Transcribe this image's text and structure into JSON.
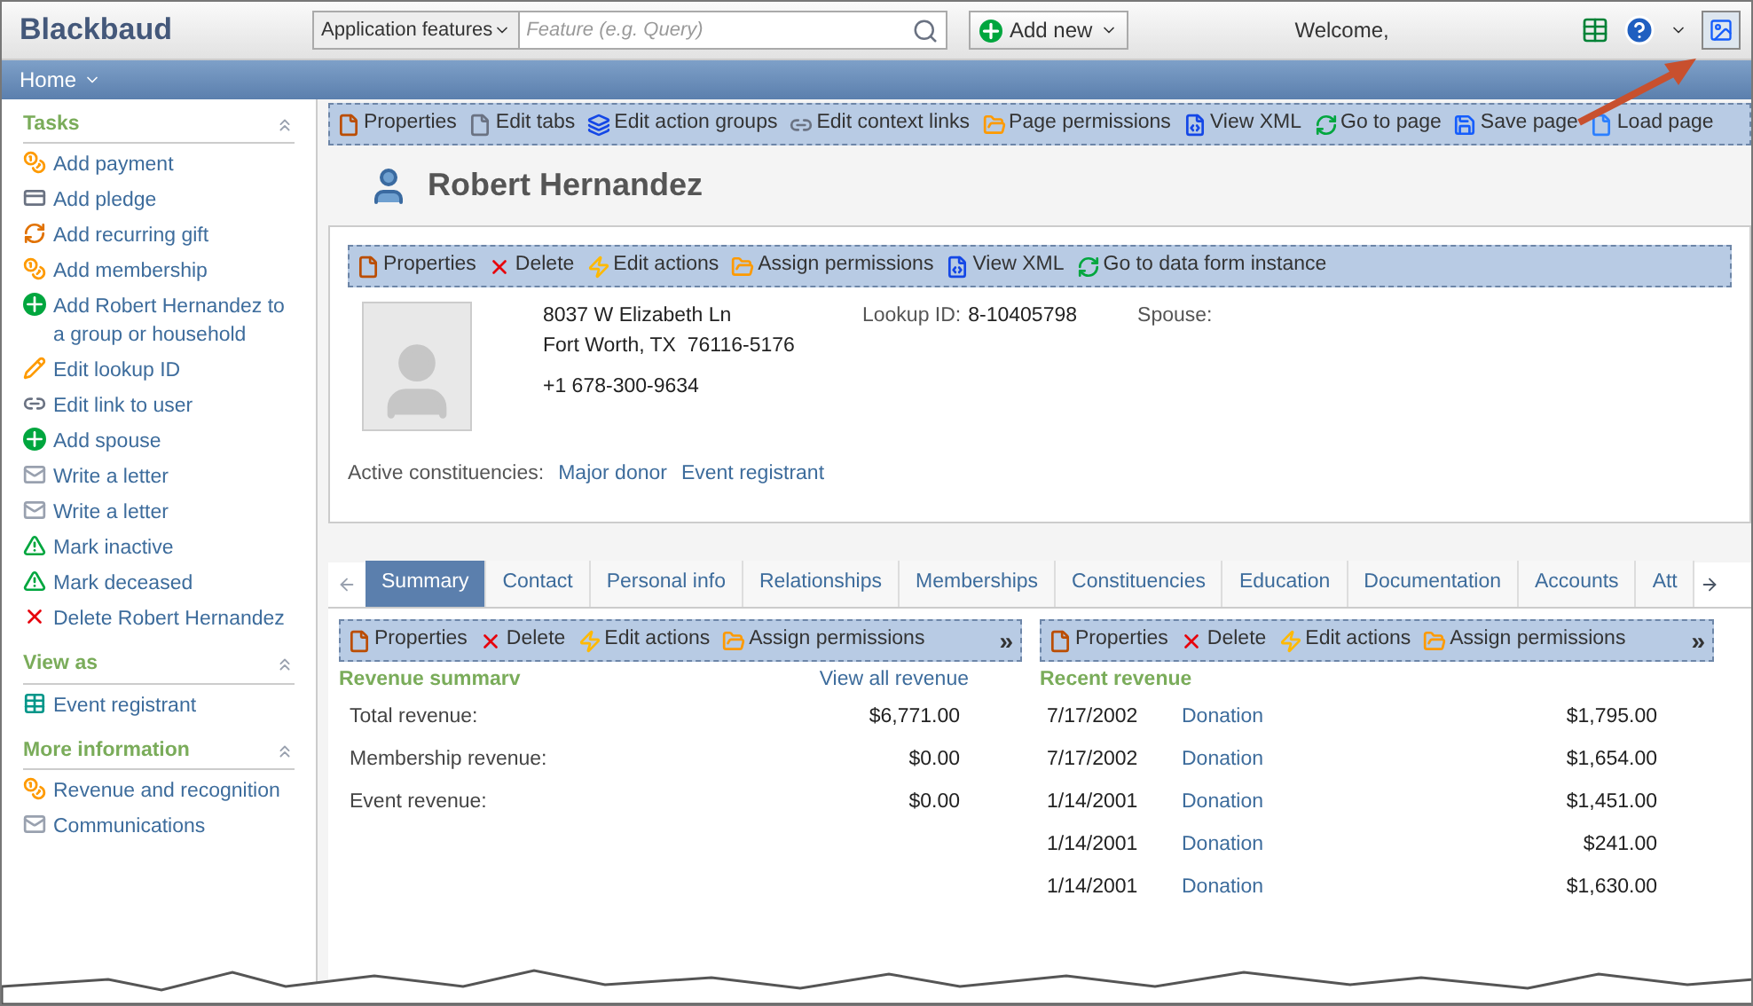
{
  "header": {
    "logo": "Blackbaud",
    "feature_menu": "Application features",
    "search": {
      "placeholder": "Feature (e.g. Query)"
    },
    "add_new": "Add new",
    "welcome": "Welcome,"
  },
  "nav": {
    "label": "Home"
  },
  "sidebar": {
    "sections": [
      {
        "title": "Tasks",
        "items": [
          "Add payment",
          "Add pledge",
          "Add recurring gift",
          "Add membership",
          "Add Robert Hernandez to a group or household",
          "Edit lookup ID",
          "Edit link to user",
          "Add spouse",
          "Write a letter",
          "Write a letter",
          "Mark inactive",
          "Mark deceased",
          "Delete Robert Hernandez"
        ]
      },
      {
        "title": "View as",
        "items": [
          "Event registrant"
        ]
      },
      {
        "title": "More information",
        "items": [
          "Revenue and recognition",
          "Communications"
        ]
      }
    ]
  },
  "page_toolbar": [
    "Properties",
    "Edit tabs",
    "Edit action groups",
    "Edit context links",
    "Page permissions",
    "View XML",
    "Go to page",
    "Save page",
    "Load page"
  ],
  "record": {
    "name": "Robert Hernandez",
    "toolbar": [
      "Properties",
      "Delete",
      "Edit actions",
      "Assign permissions",
      "View XML",
      "Go to data form instance"
    ],
    "address_lines": [
      "8037 W Elizabeth Ln",
      "Fort Worth, TX  76116-5176"
    ],
    "phone": "+1 678-300-9634",
    "lookup_label": "Lookup ID:",
    "lookup_value": "8-10405798",
    "spouse_label": "Spouse:",
    "constituencies_label": "Active constituencies:",
    "constituencies": [
      "Major donor",
      "Event registrant"
    ]
  },
  "tabs": [
    {
      "label": "Summary",
      "selected": true
    },
    {
      "label": "Contact",
      "selected": false
    },
    {
      "label": "Personal info",
      "selected": false
    },
    {
      "label": "Relationships",
      "selected": false
    },
    {
      "label": "Memberships",
      "selected": false
    },
    {
      "label": "Constituencies",
      "selected": false
    },
    {
      "label": "Education",
      "selected": false
    },
    {
      "label": "Documentation",
      "selected": false
    },
    {
      "label": "Accounts",
      "selected": false
    },
    {
      "label": "Att",
      "selected": false
    }
  ],
  "revenue_summary": {
    "toolbar": [
      "Properties",
      "Delete",
      "Edit actions",
      "Assign permissions"
    ],
    "more": "»",
    "title": "Revenue summarv",
    "link": "View all revenue",
    "rows": [
      {
        "label": "Total revenue:",
        "value": "$6,771.00"
      },
      {
        "label": "Membership revenue:",
        "value": "$0.00"
      },
      {
        "label": "Event revenue:",
        "value": "$0.00"
      }
    ]
  },
  "recent_revenue": {
    "toolbar": [
      "Properties",
      "Delete",
      "Edit actions",
      "Assign permissions"
    ],
    "more": "»",
    "title": "Recent revenue",
    "rows": [
      {
        "date": "7/17/2002",
        "type": "Donation",
        "amount": "$1,795.00"
      },
      {
        "date": "7/17/2002",
        "type": "Donation",
        "amount": "$1,654.00"
      },
      {
        "date": "1/14/2001",
        "type": "Donation",
        "amount": "$1,451.00"
      },
      {
        "date": "1/14/2001",
        "type": "Donation",
        "amount": "$241.00"
      },
      {
        "date": "1/14/2001",
        "type": "Donation",
        "amount": "$1,630.00"
      }
    ]
  }
}
